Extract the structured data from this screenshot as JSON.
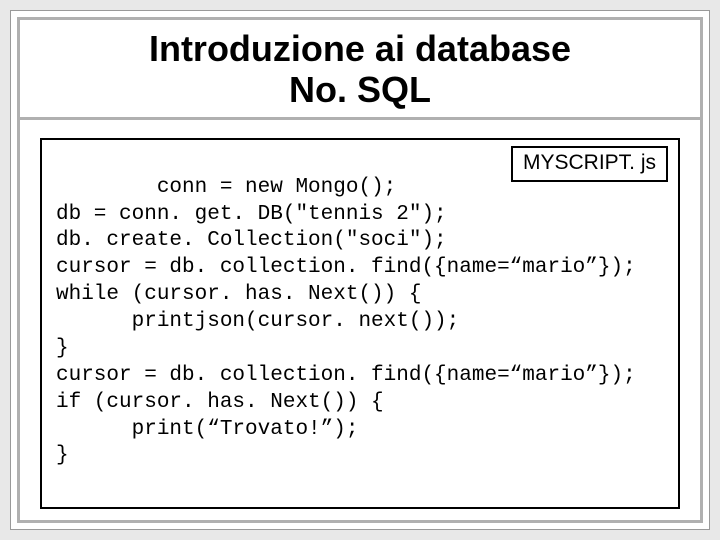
{
  "title_line1": "Introduzione ai database",
  "title_line2": "No. SQL",
  "badge": "MYSCRIPT. js",
  "code": "conn = new Mongo();\ndb = conn. get. DB(\"tennis 2\");\ndb. create. Collection(\"soci\");\ncursor = db. collection. find({name=“mario”});\nwhile (cursor. has. Next()) {\n      printjson(cursor. next());\n}\ncursor = db. collection. find({name=“mario”});\nif (cursor. has. Next()) {\n      print(“Trovato!”);\n}"
}
